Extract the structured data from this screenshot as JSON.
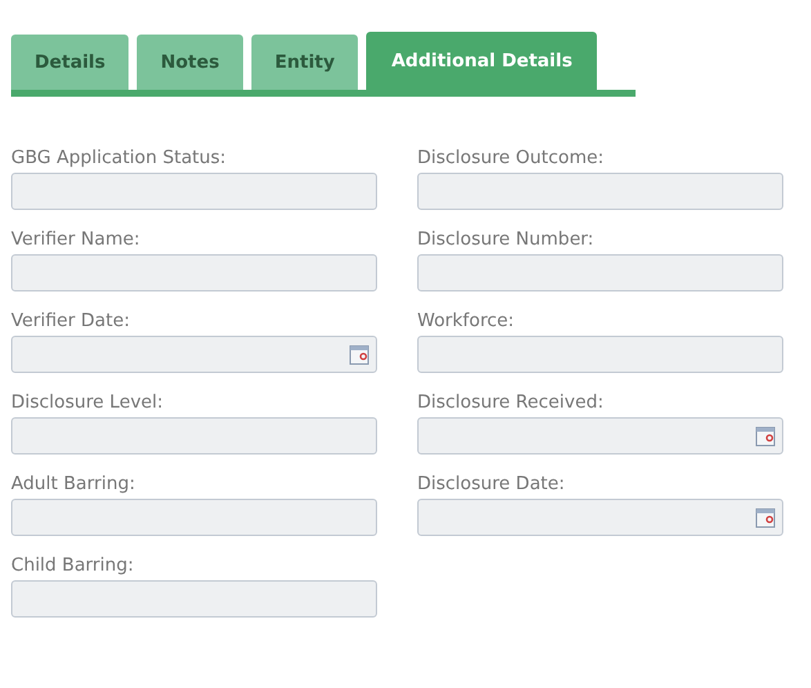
{
  "tabs": [
    {
      "label": "Details",
      "selected": false
    },
    {
      "label": "Notes",
      "selected": false
    },
    {
      "label": "Entity",
      "selected": false
    },
    {
      "label": "Additional Details",
      "selected": true
    }
  ],
  "columns": [
    [
      {
        "label": "GBG Application Status:",
        "kind": "text"
      },
      {
        "label": "Verifier Name:",
        "kind": "text"
      },
      {
        "label": "Verifier Date:",
        "kind": "date"
      },
      {
        "label": "Disclosure Level:",
        "kind": "text"
      },
      {
        "label": "Adult Barring:",
        "kind": "text"
      },
      {
        "label": "Child Barring:",
        "kind": "text"
      }
    ],
    [
      {
        "label": "Disclosure Outcome:",
        "kind": "text"
      },
      {
        "label": "Disclosure Number:",
        "kind": "text"
      },
      {
        "label": "Workforce:",
        "kind": "text"
      },
      {
        "label": "Disclosure Received:",
        "kind": "date"
      },
      {
        "label": "Disclosure Date:",
        "kind": "date"
      }
    ]
  ]
}
